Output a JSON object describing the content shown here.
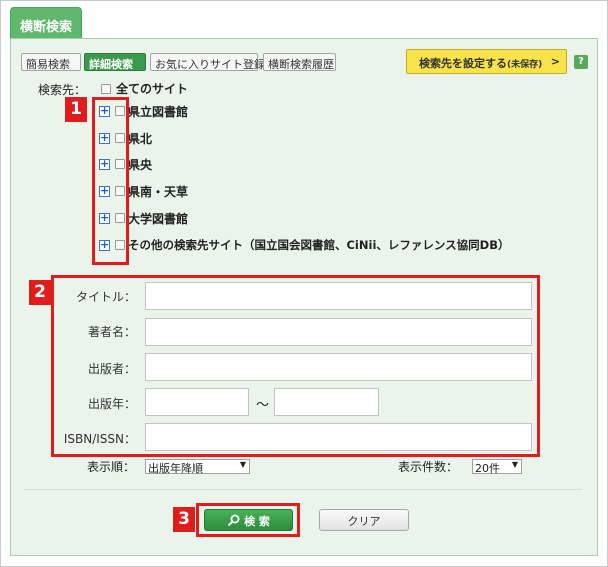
{
  "tab": {
    "label": "横断検索"
  },
  "mode_buttons": [
    {
      "label": "簡易検索",
      "active": false
    },
    {
      "label": "詳細検索",
      "active": true
    },
    {
      "label": "お気に入りサイト登録",
      "active": false
    },
    {
      "label": "横断検索履歴",
      "active": false
    }
  ],
  "set_destination": {
    "label": "検索先を設定する",
    "sub": "(未保存)",
    "arrow": ">"
  },
  "help": {
    "icon": "help-icon",
    "glyph": "?"
  },
  "search_targets": {
    "label": "検索先：",
    "all_sites": "全てのサイト",
    "sites": [
      {
        "label": "県立図書館"
      },
      {
        "label": "県北"
      },
      {
        "label": "県央"
      },
      {
        "label": "県南・天草"
      },
      {
        "label": "大学図書館"
      },
      {
        "label": "その他の検索先サイト（国立国会図書館、CiNii、レファレンス協同DB）"
      }
    ]
  },
  "callouts": {
    "one": "1",
    "two": "2",
    "three": "3"
  },
  "form": {
    "title_label": "タイトル：",
    "title_value": "",
    "author_label": "著者名：",
    "author_value": "",
    "publisher_label": "出版者：",
    "publisher_value": "",
    "year_label": "出版年：",
    "year_from": "",
    "year_sep": "～",
    "year_to": "",
    "isbn_label": "ISBN/ISSN：",
    "isbn_value": ""
  },
  "sort": {
    "label": "表示順：",
    "selected": "出版年降順"
  },
  "count": {
    "label": "表示件数：",
    "selected": "20件"
  },
  "buttons": {
    "search": "検 索",
    "search_icon": "magnifier-icon",
    "clear": "クリア"
  },
  "colors": {
    "accent_green": "#3c9a4d",
    "highlight_red": "#e01c1c",
    "set_button_yellow": "#f7e34a"
  }
}
